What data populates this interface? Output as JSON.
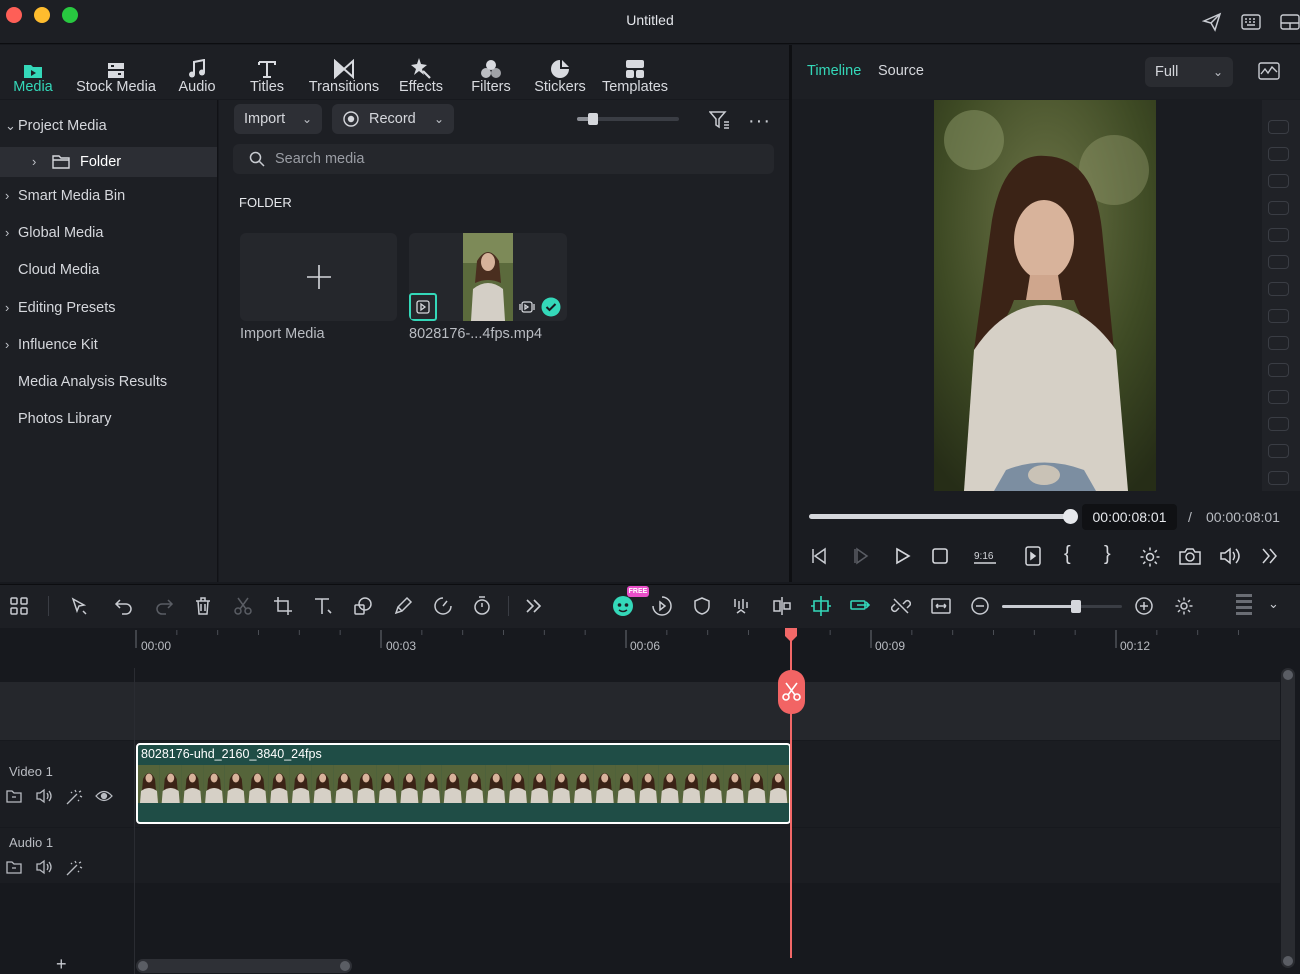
{
  "window": {
    "title": "Untitled"
  },
  "media_tabs": [
    {
      "label": "Media",
      "icon": "media-folder-icon",
      "active": true
    },
    {
      "label": "Stock Media",
      "icon": "stock-media-icon"
    },
    {
      "label": "Audio",
      "icon": "music-note-icon"
    },
    {
      "label": "Titles",
      "icon": "titles-t-icon"
    },
    {
      "label": "Transitions",
      "icon": "transitions-bowtie-icon"
    },
    {
      "label": "Effects",
      "icon": "effects-star-icon"
    },
    {
      "label": "Filters",
      "icon": "filters-circles-icon"
    },
    {
      "label": "Stickers",
      "icon": "stickers-icon"
    },
    {
      "label": "Templates",
      "icon": "templates-grid-icon"
    }
  ],
  "sidebar": {
    "items": [
      {
        "label": "Project Media",
        "expanded": true
      },
      {
        "label": "Folder",
        "selected": true
      },
      {
        "label": "Smart Media Bin"
      },
      {
        "label": "Global Media"
      },
      {
        "label": "Cloud Media"
      },
      {
        "label": "Editing Presets"
      },
      {
        "label": "Influence Kit"
      },
      {
        "label": "Media Analysis Results"
      },
      {
        "label": "Photos Library"
      }
    ]
  },
  "media": {
    "import_label": "Import",
    "record_label": "Record",
    "search_placeholder": "Search media",
    "section_title": "FOLDER",
    "import_card_label": "Import Media",
    "clip_card_label": "8028176-...4fps.mp4"
  },
  "player": {
    "tabs": [
      "Timeline",
      "Source"
    ],
    "active_tab": "Timeline",
    "quality": "Full",
    "current_time": "00:00:08:01",
    "separator": "/",
    "total_time": "00:00:08:01",
    "progress": 1.0
  },
  "toolbar": {
    "badge": "FREE"
  },
  "timeline": {
    "ticks": [
      "00:00",
      "00:03",
      "00:06",
      "00:09",
      "00:12"
    ],
    "tracks": [
      {
        "name": "Video 1"
      },
      {
        "name": "Audio 1"
      }
    ],
    "clip_name": "8028176-uhd_2160_3840_24fps",
    "add_track_label": "+"
  },
  "colors": {
    "accent": "#34d8b9",
    "playhead": "#f26868",
    "clip_bg": "#1f4d46",
    "panel": "#1d1f24"
  }
}
